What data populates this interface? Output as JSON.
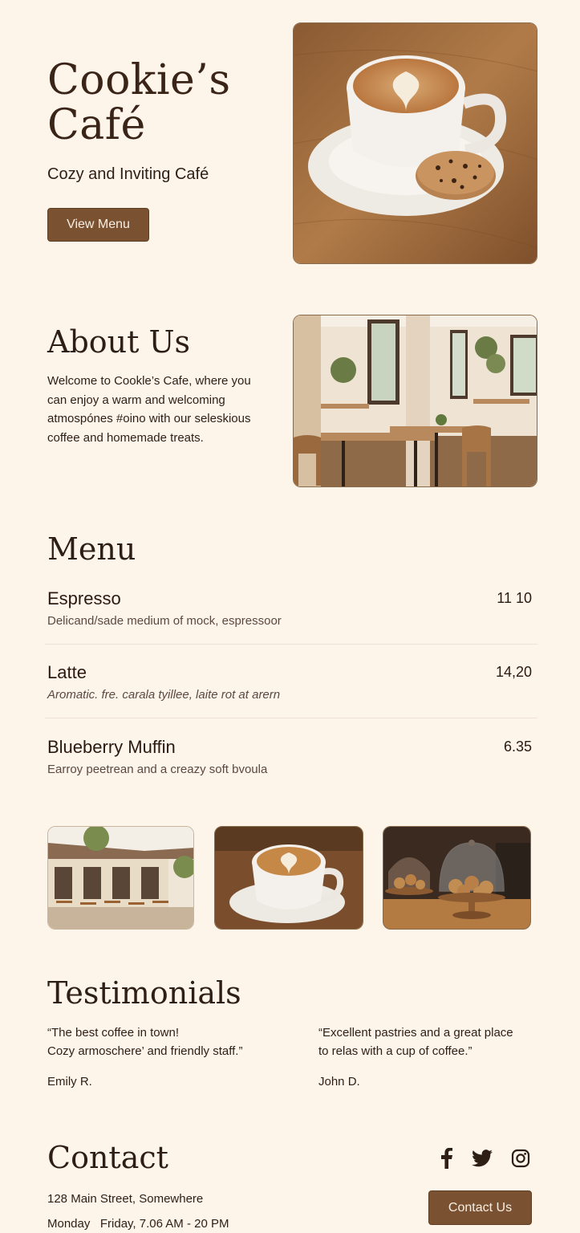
{
  "hero": {
    "title_line1": "Cookie’s",
    "title_line2": "Café",
    "subtitle": "Cozy and Inviting Café",
    "button_label": "View Menu"
  },
  "about": {
    "heading": "About Us",
    "text": "Welcome to Cookle’s Cafe, where you can enjoy a warm and welcoming atmospónes #oino with our seleskious coffee and homemade treats."
  },
  "menu": {
    "heading": "Menu",
    "items": [
      {
        "name": "Espresso",
        "price": "11 10",
        "description": "Delicand/sade medium of mock, espressoor"
      },
      {
        "name": "Latte",
        "price": "14,20",
        "description": "Aromatic. fre. carala tyillee, laite rot at arern"
      },
      {
        "name": "Blueberry Muffin",
        "price": "6.35",
        "description": "Earroy peetrean and a creazy soft bvoula"
      }
    ]
  },
  "testimonials": {
    "heading": "Testimonials",
    "items": [
      {
        "line1": "“The best coffee in town!",
        "line2": "Cozy armoschere’ and friendly staff.”",
        "author": "Emily R."
      },
      {
        "line1": "“Excellent pastries and a great place",
        "line2": "to relas with a cup of coffee.”",
        "author": "John D."
      }
    ]
  },
  "contact": {
    "heading": "Contact",
    "address": "128 Main Street, Somewhere",
    "hours": "Monday   Friday, 7.06 AM - 20 PM",
    "button_label": "Contact Us",
    "social": [
      "facebook-icon",
      "twitter-icon",
      "instagram-icon"
    ]
  },
  "colors": {
    "background": "#fdf4ea",
    "accent": "#7a5232",
    "text": "#2e1f15"
  }
}
